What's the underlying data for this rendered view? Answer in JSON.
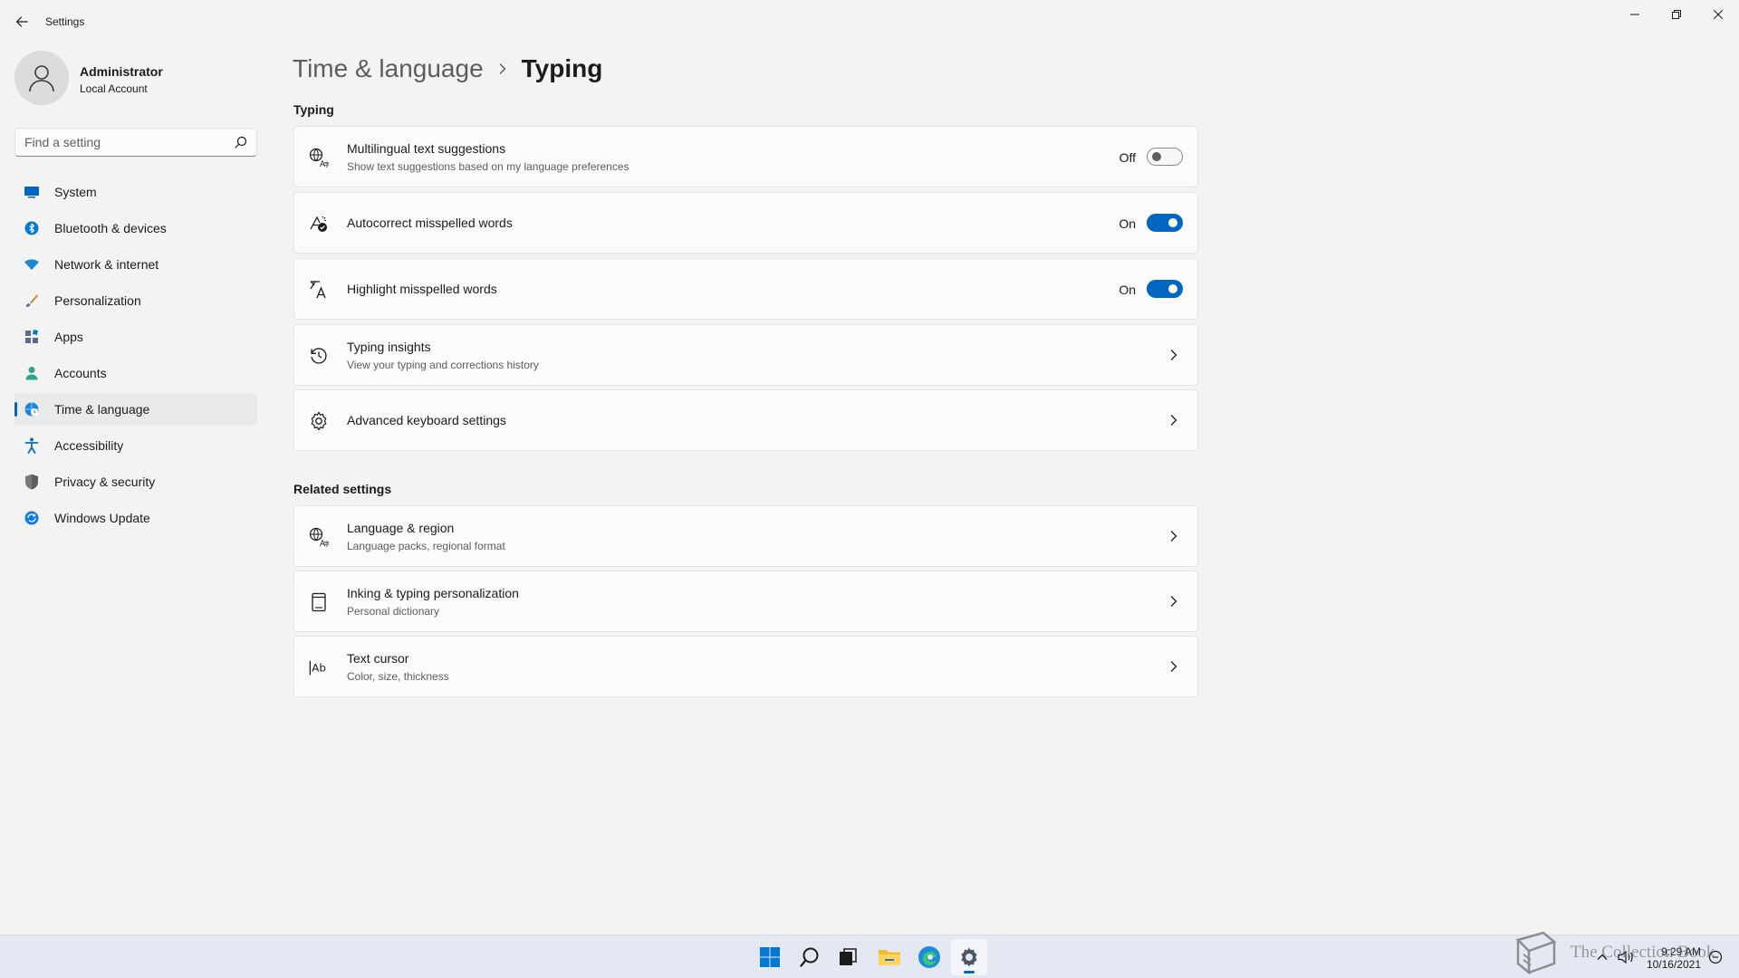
{
  "window": {
    "title": "Settings"
  },
  "profile": {
    "name": "Administrator",
    "account_type": "Local Account"
  },
  "search": {
    "placeholder": "Find a setting"
  },
  "sidebar": {
    "items": [
      {
        "label": "System",
        "icon": "monitor-icon",
        "color": "#0067c0"
      },
      {
        "label": "Bluetooth & devices",
        "icon": "bluetooth-icon",
        "color": "#0078d4"
      },
      {
        "label": "Network & internet",
        "icon": "wifi-icon",
        "color": "#1a86d9"
      },
      {
        "label": "Personalization",
        "icon": "brush-icon",
        "color": "#d08a3c"
      },
      {
        "label": "Apps",
        "icon": "apps-icon",
        "color": "#5b6b8c"
      },
      {
        "label": "Accounts",
        "icon": "person-icon",
        "color": "#2ba889"
      },
      {
        "label": "Time & language",
        "icon": "globe-clock-icon",
        "color": "#1a86d9",
        "selected": true
      },
      {
        "label": "Accessibility",
        "icon": "accessibility-icon",
        "color": "#0f6cbd"
      },
      {
        "label": "Privacy & security",
        "icon": "shield-icon",
        "color": "#6b6b6b"
      },
      {
        "label": "Windows Update",
        "icon": "update-icon",
        "color": "#0f7ae5"
      }
    ]
  },
  "breadcrumb": {
    "parent": "Time & language",
    "current": "Typing"
  },
  "typing_section": {
    "title": "Typing",
    "cards": [
      {
        "title": "Multilingual text suggestions",
        "subtitle": "Show text suggestions based on my language preferences",
        "icon": "language-suggest-icon",
        "toggle": "Off"
      },
      {
        "title": "Autocorrect misspelled words",
        "icon": "autocorrect-icon",
        "toggle": "On"
      },
      {
        "title": "Highlight misspelled words",
        "icon": "spellcheck-icon",
        "toggle": "On"
      },
      {
        "title": "Typing insights",
        "subtitle": "View your typing and corrections history",
        "icon": "history-icon"
      },
      {
        "title": "Advanced keyboard settings",
        "icon": "gear-icon"
      }
    ]
  },
  "related_section": {
    "title": "Related settings",
    "cards": [
      {
        "title": "Language & region",
        "subtitle": "Language packs, regional format",
        "icon": "language-icon"
      },
      {
        "title": "Inking & typing personalization",
        "subtitle": "Personal dictionary",
        "icon": "notebook-icon"
      },
      {
        "title": "Text cursor",
        "subtitle": "Color, size, thickness",
        "icon": "text-cursor-icon",
        "icon_text": "Ab"
      }
    ]
  },
  "taskbar": {
    "apps": [
      "start-icon",
      "search-icon",
      "task-view-icon",
      "file-explorer-icon",
      "edge-icon",
      "settings-icon"
    ],
    "active_app": "settings-icon",
    "time": "9:29 AM",
    "date": "10/16/2021"
  },
  "watermark": {
    "text": "The Collection Book"
  },
  "colors": {
    "accent": "#0067c0",
    "background": "#f3f3f3",
    "card": "#fbfbfb"
  }
}
